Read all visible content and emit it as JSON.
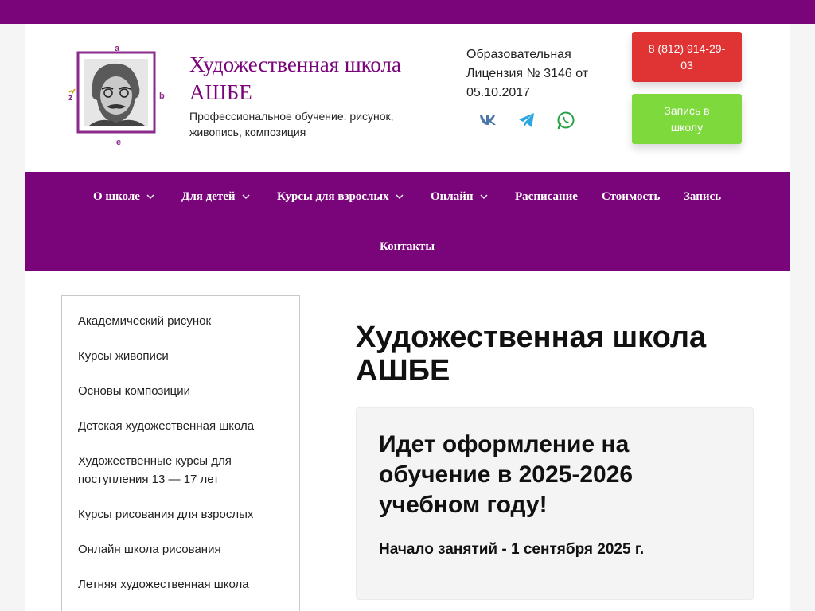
{
  "header": {
    "title": "Художественная школа АШБЕ",
    "description": "Профессиональное обучение: рисунок, живопись, композиция",
    "license": "Образовательная Лицензия № 3146 от 05.10.2017",
    "logo_letters": {
      "top": "a",
      "right": "b",
      "bottom": "e",
      "left": "z"
    },
    "phone_button": "8 (812) 914-29-03",
    "signup_button": "Запись в школу",
    "socials": [
      "vk-icon",
      "telegram-icon",
      "whatsapp-icon"
    ]
  },
  "nav": {
    "items": [
      {
        "label": "О школе",
        "dropdown": true
      },
      {
        "label": "Для детей",
        "dropdown": true
      },
      {
        "label": "Курсы для взрослых",
        "dropdown": true
      },
      {
        "label": "Онлайн",
        "dropdown": true
      },
      {
        "label": "Расписание",
        "dropdown": false
      },
      {
        "label": "Стоимость",
        "dropdown": false
      },
      {
        "label": "Запись",
        "dropdown": false
      },
      {
        "label": "Контакты",
        "dropdown": false
      }
    ]
  },
  "sidebar": {
    "links": [
      "Академический рисунок",
      "Курсы живописи",
      "Основы композиции",
      "Детская художественная школа",
      "Художественные курсы для поступления 13 — 17 лет",
      "Курсы рисования для взрослых",
      "Онлайн школа рисования",
      "Летняя художественная школа"
    ]
  },
  "main": {
    "title": "Художественная школа АШБЕ",
    "notice_title": "Идет оформление на обучение в 2025-2026 учебном году!",
    "notice_sub": "Начало занятий - 1 сентября 2025 г."
  },
  "colors": {
    "brand": "#7a057a",
    "phone": "#e03434",
    "signup": "#7ed93d"
  }
}
